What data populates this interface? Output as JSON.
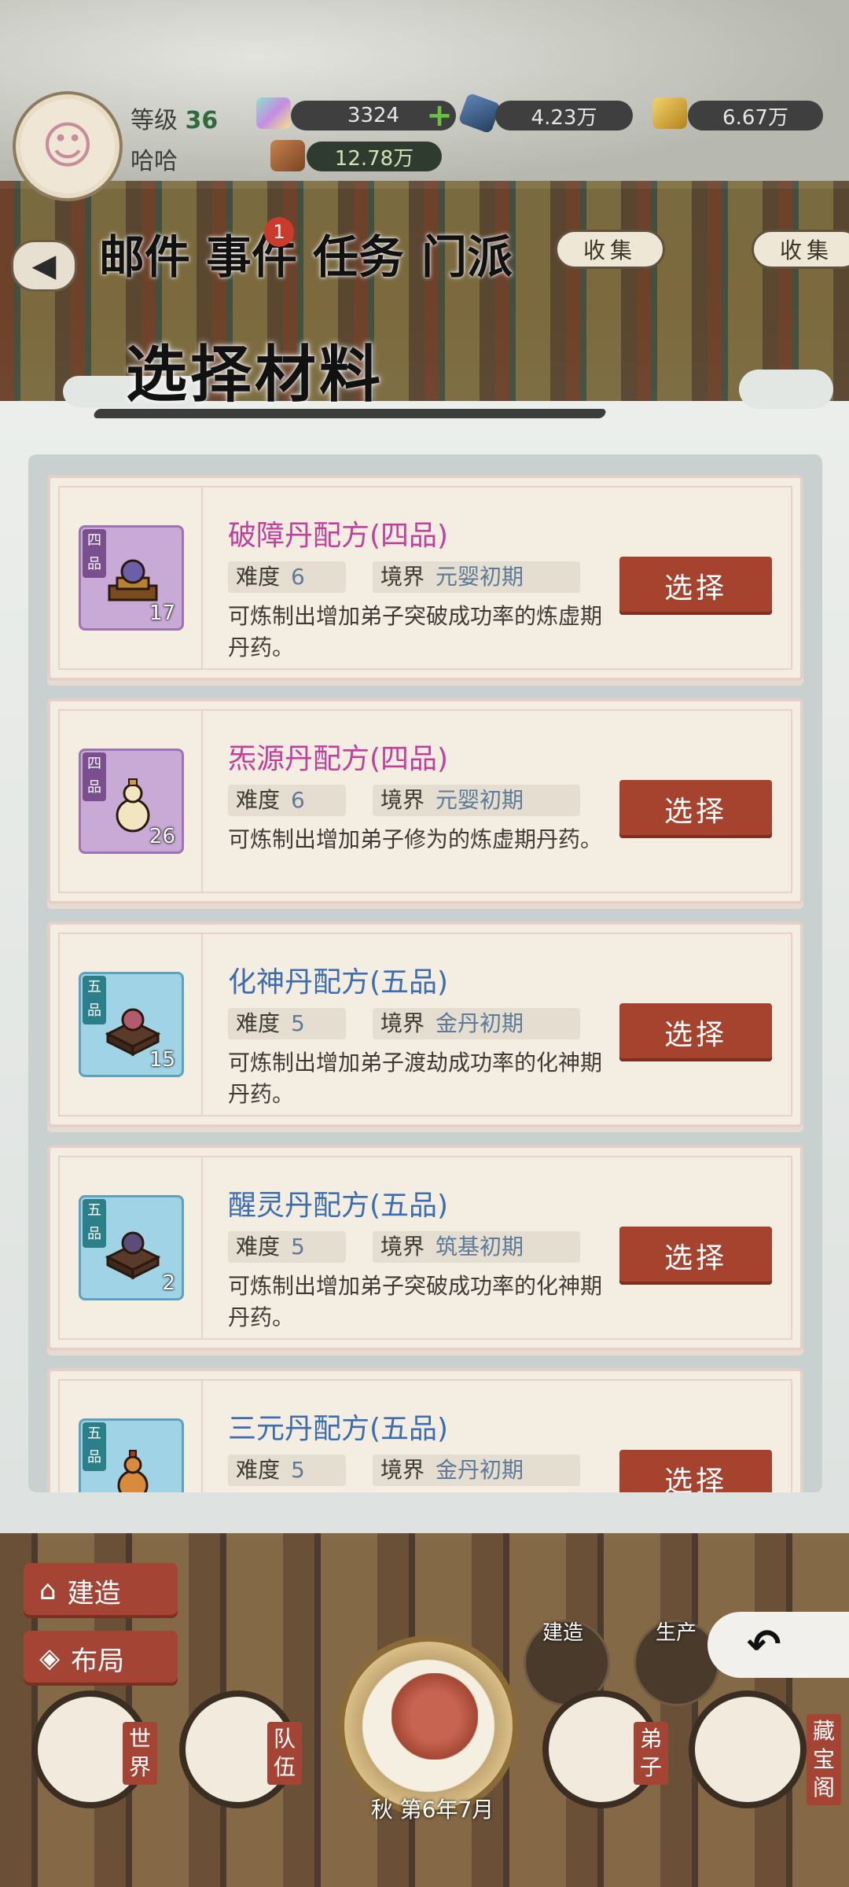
{
  "player": {
    "level_label": "等级",
    "level": "36",
    "name": "哈哈"
  },
  "resources": {
    "gem": "3324",
    "crystal": "4.23万",
    "gold": "6.67万",
    "ore": "12.78万"
  },
  "nav": {
    "items": [
      {
        "label": "邮件"
      },
      {
        "label": "事件",
        "badge": "1"
      },
      {
        "label": "任务"
      },
      {
        "label": "门派"
      }
    ],
    "collect_1": "收集",
    "collect_2": "收集"
  },
  "modal": {
    "title": "选择材料",
    "difficulty_label": "难度",
    "realm_label": "境界",
    "select_label": "选择",
    "items": [
      {
        "name": "破障丹配方(四品)",
        "grade": "四品",
        "count": "17",
        "difficulty": "6",
        "realm": "元婴初期",
        "desc": "可炼制出增加弟子突破成功率的炼虚期丹药。",
        "tier": "purple",
        "art": "pedestal-orb-icon"
      },
      {
        "name": "炁源丹配方(四品)",
        "grade": "四品",
        "count": "26",
        "difficulty": "6",
        "realm": "元婴初期",
        "desc": "可炼制出增加弟子修为的炼虚期丹药。",
        "tier": "purple",
        "art": "gourd-icon"
      },
      {
        "name": "化神丹配方(五品)",
        "grade": "五品",
        "count": "15",
        "difficulty": "5",
        "realm": "金丹初期",
        "desc": "可炼制出增加弟子渡劫成功率的化神期丹药。",
        "tier": "blue",
        "art": "pedestal-orb-icon"
      },
      {
        "name": "醒灵丹配方(五品)",
        "grade": "五品",
        "count": "2",
        "difficulty": "5",
        "realm": "筑基初期",
        "desc": "可炼制出增加弟子突破成功率的化神期丹药。",
        "tier": "blue",
        "art": "pedestal-orb-icon"
      },
      {
        "name": "三元丹配方(五品)",
        "grade": "五品",
        "count": "",
        "difficulty": "5",
        "realm": "金丹初期",
        "desc": "",
        "tier": "blue",
        "art": "gourd-icon"
      }
    ]
  },
  "bottom": {
    "build": "建造",
    "layout": "布局",
    "world": "世界",
    "team": "队伍",
    "disciple": "弟子",
    "treasury": "藏宝阁",
    "season": "秋",
    "date": "第6年7月",
    "build_small": "建造",
    "produce_small": "生产"
  },
  "colors": {
    "select_button": "#a5432f",
    "purple_name": "#c23f9b",
    "blue_name": "#3c6db0"
  }
}
